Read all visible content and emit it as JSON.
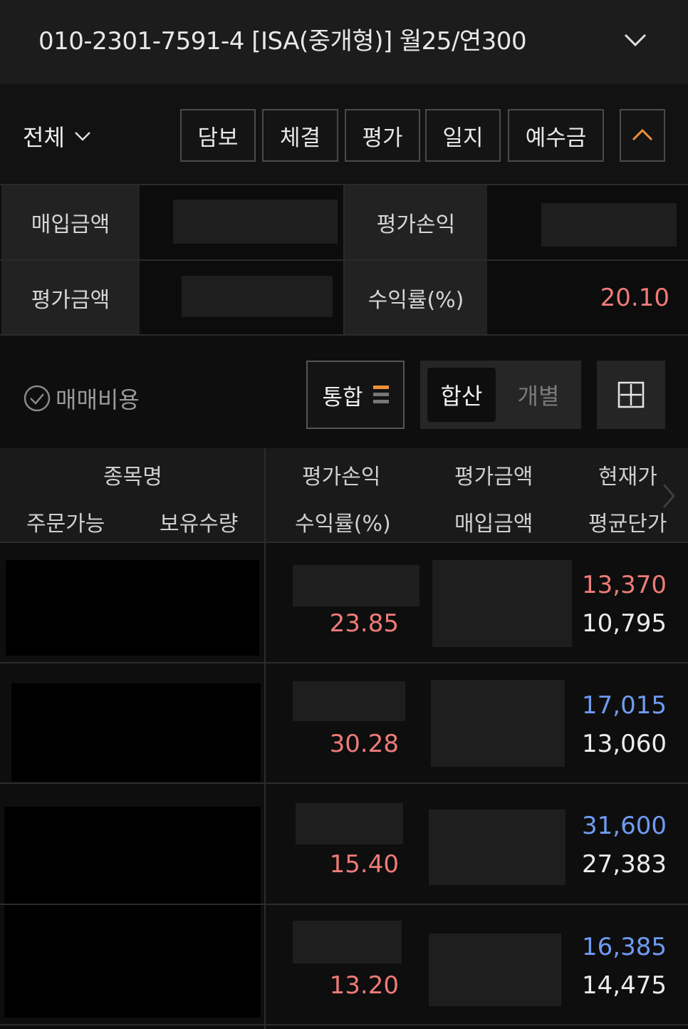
{
  "header": {
    "account": "010-2301-7591-4  [ISA(중개형)] 월25/연300",
    "dropdown_icon": "chevron-down-icon"
  },
  "toolbar": {
    "filter": "전체",
    "buttons": [
      "담보",
      "체결",
      "평가",
      "일지",
      "예수금"
    ],
    "collapse_icon": "chevron-up-icon"
  },
  "summary": {
    "purchase_amount_label": "매입금액",
    "eval_pl_label": "평가손익",
    "eval_amount_label": "평가금액",
    "return_rate_label": "수익률(%)",
    "return_rate_value": "20.10"
  },
  "options": {
    "trade_cost": "매매비용",
    "merge": "통합",
    "seg_sum": "합산",
    "seg_individual": "개별"
  },
  "table": {
    "headers": {
      "name": "종목명",
      "eval_pl": "평가손익",
      "eval_amount": "평가금액",
      "current_price": "현재가",
      "orderable": "주문가능",
      "holding_qty": "보유수량",
      "return_rate": "수익률(%)",
      "purchase_amount": "매입금액",
      "avg_price": "평균단가"
    },
    "rows": [
      {
        "return_rate": "23.85",
        "current_price": "13,370",
        "avg_price": "10,795"
      },
      {
        "return_rate": "30.28",
        "current_price": "17,015",
        "avg_price": "13,060"
      },
      {
        "return_rate": "15.40",
        "current_price": "31,600",
        "avg_price": "27,383"
      },
      {
        "return_rate": "13.20",
        "current_price": "16,385",
        "avg_price": "14,475"
      }
    ]
  },
  "colors": {
    "up": "#ee7b78",
    "down": "#6f9bf2",
    "accent": "#f0913a"
  }
}
